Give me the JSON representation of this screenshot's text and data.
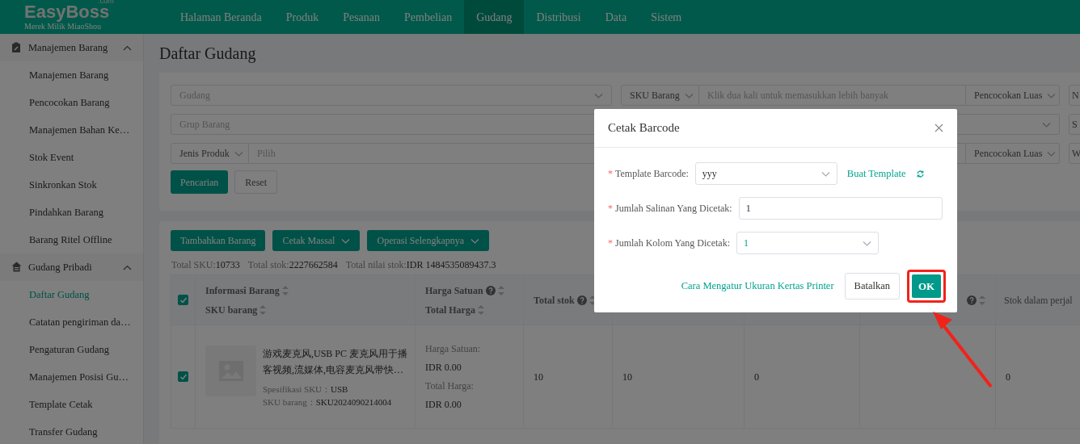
{
  "brand": {
    "logo": "EasyBoss",
    "logo_suffix": ".com",
    "tagline": "Merek Milik MiaoShou"
  },
  "nav": [
    {
      "label": "Halaman Beranda",
      "selected": false
    },
    {
      "label": "Produk",
      "selected": false
    },
    {
      "label": "Pesanan",
      "selected": false
    },
    {
      "label": "Pembelian",
      "selected": false
    },
    {
      "label": "Gudang",
      "selected": true
    },
    {
      "label": "Distribusi",
      "selected": false
    },
    {
      "label": "Data",
      "selected": false
    },
    {
      "label": "Sistem",
      "selected": false
    }
  ],
  "sidebar": {
    "groups": [
      {
        "label": "Manajemen Barang",
        "expanded": true,
        "items": [
          {
            "label": "Manajemen Barang",
            "selected": false
          },
          {
            "label": "Pencocokan Barang",
            "selected": false
          },
          {
            "label": "Manajemen Bahan Ke…",
            "selected": false
          },
          {
            "label": "Stok Event",
            "selected": false
          },
          {
            "label": "Sinkronkan Stok",
            "selected": false
          },
          {
            "label": "Pindahkan Barang",
            "selected": false
          },
          {
            "label": "Barang Ritel Offline",
            "selected": false
          }
        ]
      },
      {
        "label": "Gudang Pribadi",
        "expanded": true,
        "items": [
          {
            "label": "Daftar Gudang",
            "selected": true
          },
          {
            "label": "Catatan pengiriman da…",
            "selected": false
          },
          {
            "label": "Pengaturan Gudang",
            "selected": false
          },
          {
            "label": "Manajemen Posisi Gu…",
            "selected": false
          },
          {
            "label": "Template Cetak",
            "selected": false
          },
          {
            "label": "Transfer Gudang",
            "selected": false
          }
        ]
      }
    ]
  },
  "page_title": "Daftar Gudang",
  "filters": [
    {
      "kind": "select",
      "placeholder": "Gudang"
    },
    {
      "kind": "compound",
      "prefix": "SKU Barang",
      "placeholder": "Klik dua kali untuk memasukkan lebih banyak",
      "suffix": "Pencocokan Luas"
    },
    {
      "kind": "cut",
      "value": "N"
    },
    {
      "kind": "select_wide",
      "placeholder": "Grup Barang"
    },
    {
      "kind": "cut",
      "value": "S"
    },
    {
      "kind": "compound_wide",
      "prefix": "Jenis Produk",
      "placeholder": "Pilih",
      "suffix": "Pencocokan Luas"
    },
    {
      "kind": "cut",
      "value": "W"
    }
  ],
  "filter_buttons": {
    "search": "Pencarian",
    "reset": "Reset"
  },
  "toolbar": [
    {
      "label": "Tambahkan Barang",
      "dropdown": false
    },
    {
      "label": "Cetak Massal",
      "dropdown": true
    },
    {
      "label": "Operasi Selengkapnya",
      "dropdown": true
    }
  ],
  "summary": [
    {
      "label": "Total SKU:",
      "value": "10733"
    },
    {
      "label": "Total stok:",
      "value": "2227662584"
    },
    {
      "label": "Total nilai stok:",
      "value": "IDR 1484535089437.3"
    }
  ],
  "table": {
    "select_all": true,
    "columns": [
      {
        "label": "Informasi Barang",
        "label_2": "SKU barang",
        "help": false
      },
      {
        "label": "Harga Satuan",
        "label_2": "Total Harga",
        "help": true
      },
      {
        "label": "Total stok",
        "help": true
      },
      {
        "help": true
      },
      {
        "label": "Stok dalam perjal",
        "help": false
      }
    ],
    "rows": [
      {
        "checked": true,
        "title": "游戏麦克风,USB PC 麦克风用于播客视频,流媒体,电容麦克风带快…",
        "spec_label": "Spesifikasi SKU：",
        "spec": "USB",
        "sku_label": "SKU barang：",
        "sku": "SKU2024090214004",
        "price_label": "Harga Satuan:",
        "price": "IDR 0.00",
        "total_label": "Total Harga:",
        "total": "IDR 0.00",
        "stock": [
          "10",
          "10",
          "0",
          "0"
        ]
      }
    ]
  },
  "dialog": {
    "title": "Cetak Barcode",
    "fields": [
      {
        "kind": "select",
        "mark": "*",
        "label": "Template Barcode:",
        "value": "yyy",
        "link": "Buat Template"
      },
      {
        "kind": "input",
        "mark": "*",
        "label": "Jumlah Salinan Yang Dicetak:",
        "value": "1"
      },
      {
        "kind": "select",
        "mark": "*",
        "label": "Jumlah Kolom Yang Dicetak:",
        "value": "1"
      }
    ],
    "help_link": "Cara Mengatur Ukuran Kertas Printer",
    "cancel": "Batalkan",
    "ok": "OK"
  }
}
